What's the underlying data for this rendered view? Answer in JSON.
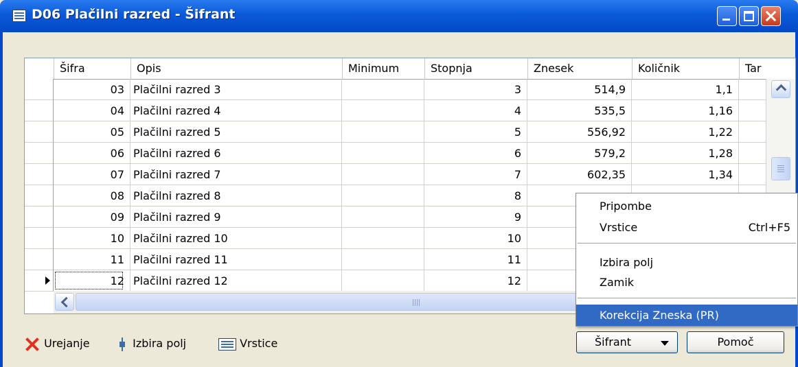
{
  "window": {
    "title": "D06 Plačilni razred - Šifrant"
  },
  "grid": {
    "columns": [
      "Šifra",
      "Opis",
      "Minimum",
      "Stopnja",
      "Znesek",
      "Količnik",
      "Tar"
    ],
    "rows": [
      {
        "sifra": "03",
        "opis": "Plačilni razred 3",
        "minimum": "",
        "stopnja": "3",
        "znesek": "514,9",
        "kolicnik": "1,1"
      },
      {
        "sifra": "04",
        "opis": "Plačilni razred 4",
        "minimum": "",
        "stopnja": "4",
        "znesek": "535,5",
        "kolicnik": "1,16"
      },
      {
        "sifra": "05",
        "opis": "Plačilni razred 5",
        "minimum": "",
        "stopnja": "5",
        "znesek": "556,92",
        "kolicnik": "1,22"
      },
      {
        "sifra": "06",
        "opis": "Plačilni razred 6",
        "minimum": "",
        "stopnja": "6",
        "znesek": "579,2",
        "kolicnik": "1,28"
      },
      {
        "sifra": "07",
        "opis": "Plačilni razred 7",
        "minimum": "",
        "stopnja": "7",
        "znesek": "602,35",
        "kolicnik": "1,34"
      },
      {
        "sifra": "08",
        "opis": "Plačilni razred 8",
        "minimum": "",
        "stopnja": "8",
        "znesek": "",
        "kolicnik": ""
      },
      {
        "sifra": "09",
        "opis": "Plačilni razred 9",
        "minimum": "",
        "stopnja": "9",
        "znesek": "",
        "kolicnik": ""
      },
      {
        "sifra": "10",
        "opis": "Plačilni razred 10",
        "minimum": "",
        "stopnja": "10",
        "znesek": "",
        "kolicnik": ""
      },
      {
        "sifra": "11",
        "opis": "Plačilni razred 11",
        "minimum": "",
        "stopnja": "11",
        "znesek": "",
        "kolicnik": ""
      },
      {
        "sifra": "12",
        "opis": "Plačilni razred 12",
        "minimum": "",
        "stopnja": "12",
        "znesek": "",
        "kolicnik": ""
      }
    ],
    "current_row_index": 9
  },
  "toolbar": {
    "urejanje": "Urejanje",
    "izbira_polj": "Izbira polj",
    "vrstice": "Vrstice"
  },
  "buttons": {
    "sifrant": "Šifrant",
    "pomoc": "Pomoč"
  },
  "context_menu": {
    "items": [
      {
        "label": "Pripombe",
        "shortcut": ""
      },
      {
        "label": "Vrstice",
        "shortcut": "Ctrl+F5"
      },
      {
        "label": "Izbira polj",
        "shortcut": ""
      },
      {
        "label": "Zamik",
        "shortcut": ""
      },
      {
        "label": "Korekcija Zneska (PR)",
        "shortcut": "",
        "highlighted": true
      }
    ]
  },
  "colors": {
    "titlebar": "#0a5ad8",
    "menu_highlight": "#316ac5",
    "close_button": "#c63a1c"
  }
}
